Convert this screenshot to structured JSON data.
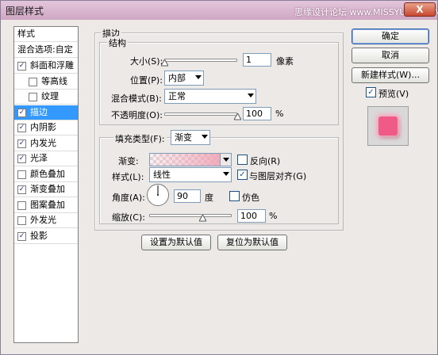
{
  "window": {
    "title": "图层样式",
    "watermark": "思缘设计论坛 www.MISSYUAN.COM",
    "close": "X"
  },
  "style_list": {
    "header": "样式",
    "blend_options": "混合选项:自定",
    "items": [
      {
        "label": "斜面和浮雕",
        "checked": true,
        "indent": false,
        "selected": false
      },
      {
        "label": "等高线",
        "checked": false,
        "indent": true,
        "selected": false
      },
      {
        "label": "纹理",
        "checked": false,
        "indent": true,
        "selected": false
      },
      {
        "label": "描边",
        "checked": true,
        "indent": false,
        "selected": true
      },
      {
        "label": "内阴影",
        "checked": true,
        "indent": false,
        "selected": false
      },
      {
        "label": "内发光",
        "checked": true,
        "indent": false,
        "selected": false
      },
      {
        "label": "光泽",
        "checked": true,
        "indent": false,
        "selected": false
      },
      {
        "label": "颜色叠加",
        "checked": false,
        "indent": false,
        "selected": false
      },
      {
        "label": "渐变叠加",
        "checked": true,
        "indent": false,
        "selected": false
      },
      {
        "label": "图案叠加",
        "checked": false,
        "indent": false,
        "selected": false
      },
      {
        "label": "外发光",
        "checked": false,
        "indent": false,
        "selected": false
      },
      {
        "label": "投影",
        "checked": true,
        "indent": false,
        "selected": false
      }
    ]
  },
  "stroke": {
    "section_title": "描边",
    "structure_title": "结构",
    "size_label": "大小(S):",
    "size_value": "1",
    "size_unit": "像素",
    "size_fraction": 0.0,
    "position_label": "位置(P):",
    "position_value": "内部",
    "blend_mode_label": "混合模式(B):",
    "blend_mode_value": "正常",
    "opacity_label": "不透明度(O):",
    "opacity_value": "100",
    "opacity_unit": "%",
    "opacity_fraction": 1.0,
    "fill_type_label": "填充类型(F):",
    "fill_type_value": "渐变",
    "gradient_label": "渐变:",
    "reverse_label": "反向(R)",
    "reverse_checked": false,
    "style_label": "样式(L):",
    "style_value": "线性",
    "align_label": "与图层对齐(G)",
    "align_checked": true,
    "angle_label": "角度(A):",
    "angle_value": "90",
    "angle_unit": "度",
    "dither_label": "仿色",
    "dither_checked": false,
    "scale_label": "缩放(C):",
    "scale_value": "100",
    "scale_unit": "%",
    "scale_fraction": 0.65,
    "set_default": "设置为默认值",
    "reset_default": "复位为默认值"
  },
  "actions": {
    "ok": "确定",
    "cancel": "取消",
    "new_style": "新建样式(W)...",
    "preview_label": "预览(V)",
    "preview_checked": true,
    "check_mark": "✓"
  },
  "colors": {
    "selection": "#3399ff",
    "preview_fill": "#f05a87"
  }
}
